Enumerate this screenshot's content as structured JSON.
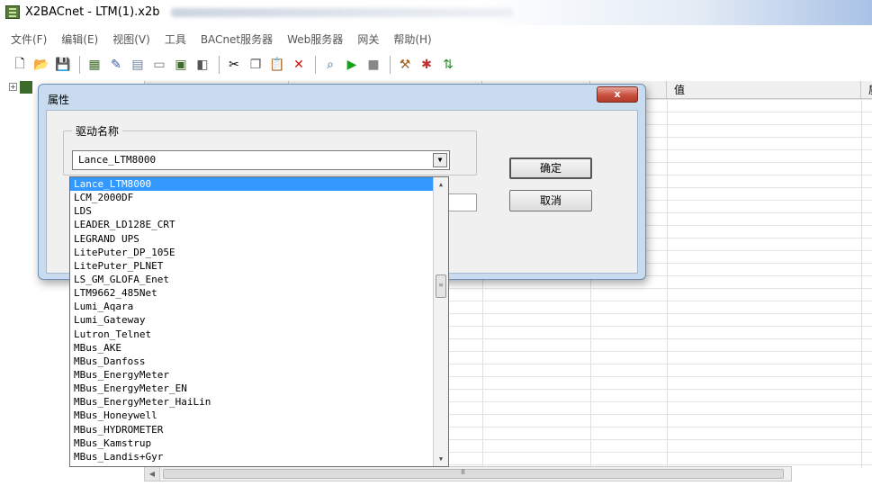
{
  "window": {
    "title": "X2BACnet - LTM(1).x2b"
  },
  "menu": [
    "文件(F)",
    "编辑(E)",
    "视图(V)",
    "工具",
    "BACnet服务器",
    "Web服务器",
    "网关",
    "帮助(H)"
  ],
  "grid": {
    "columns": [
      "",
      "",
      "",
      "",
      "值",
      "质"
    ]
  },
  "dialog": {
    "title": "属性",
    "close_label": "x",
    "group_label": "驱动名称",
    "combo_value": "Lance_LTM8000",
    "ok_label": "确定",
    "cancel_label": "取消"
  },
  "dropdown": {
    "items": [
      "Lance_LTM8000",
      "LCM_2000DF",
      "LDS",
      "LEADER_LD128E_CRT",
      "LEGRAND UPS",
      "LitePuter_DP_105E",
      "LitePuter_PLNET",
      "LS_GM_GLOFA_Enet",
      "LTM9662_485Net",
      "Lumi_Aqara",
      "Lumi_Gateway",
      "Lutron_Telnet",
      "MBus_AKE",
      "MBus_Danfoss",
      "MBus_EnergyMeter",
      "MBus_EnergyMeter_EN",
      "MBus_EnergyMeter_HaiLin",
      "MBus_Honeywell",
      "MBus_HYDROMETER",
      "MBus_Kamstrup",
      "MBus_Landis+Gyr"
    ]
  },
  "icons": {
    "toolbar": [
      "new-icon",
      "open-icon",
      "save-icon",
      "db-icon",
      "pin-icon",
      "grid-icon",
      "doc-icon",
      "device-icon",
      "props-icon",
      "cut-icon",
      "copy-icon",
      "paste-icon",
      "delete-icon",
      "search-icon",
      "run-icon",
      "stop-icon",
      "tool-icon",
      "config-icon",
      "transfer-icon"
    ]
  }
}
